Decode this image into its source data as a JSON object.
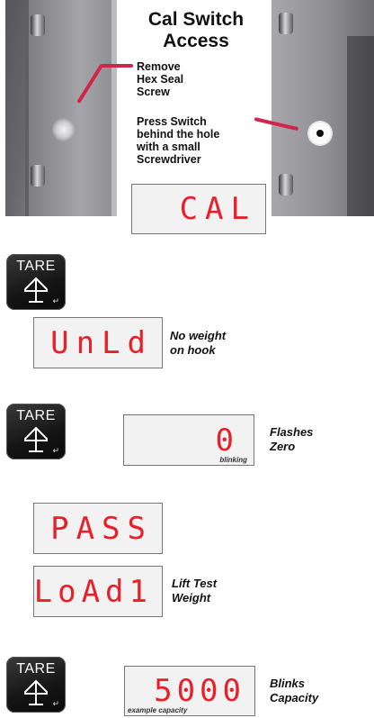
{
  "header": {
    "title_line1": "Cal Switch",
    "title_line2": "Access",
    "note_remove": [
      "Remove",
      "Hex Seal",
      "Screw"
    ],
    "note_press": [
      "Press Switch",
      "behind the hole",
      "with a small",
      "Screwdriver"
    ]
  },
  "display_cal": "CAL",
  "steps": [
    {
      "key_label": "TARE",
      "display": "UnLd",
      "caption": [
        "No weight",
        "on hook"
      ]
    },
    {
      "key_label": "TARE",
      "display": "0",
      "sub_label": "blinking",
      "caption": [
        "Flashes",
        "Zero"
      ]
    },
    {
      "display": "PASS"
    },
    {
      "display": "LoAd1",
      "caption": [
        "Lift Test",
        "Weight"
      ]
    },
    {
      "key_label": "TARE",
      "display": "5000",
      "sub_label": "example capacity",
      "caption": [
        "Blinks",
        "Capacity"
      ]
    }
  ],
  "icons": {
    "tare_arrow": "up-arrow-icon",
    "enter_symbol": "↵"
  },
  "colors": {
    "segment_red": "#e8202a",
    "pointer_red": "#d0264a",
    "key_black": "#141414"
  }
}
